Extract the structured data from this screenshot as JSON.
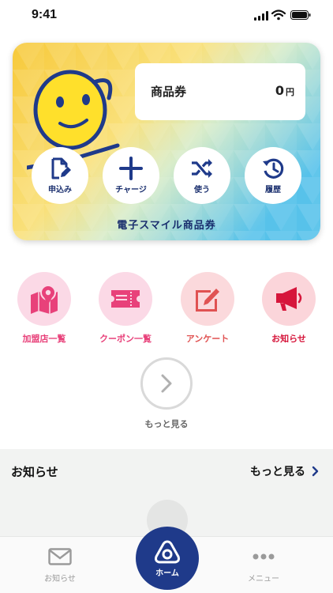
{
  "status_bar": {
    "time": "9:41"
  },
  "card": {
    "balance_label": "商品券",
    "balance_value": "0",
    "balance_unit": "円",
    "title": "電子スマイル商品券",
    "buttons": [
      {
        "label": "申込み",
        "icon": "apply-document-icon"
      },
      {
        "label": "チャージ",
        "icon": "plus-icon"
      },
      {
        "label": "使う",
        "icon": "shuffle-icon"
      },
      {
        "label": "履歴",
        "icon": "history-icon"
      }
    ]
  },
  "quick_menu": [
    {
      "label": "加盟店一覧",
      "icon": "map-pin-icon",
      "color": "#e8417a",
      "bg": "#fbd9e6"
    },
    {
      "label": "クーポン一覧",
      "icon": "ticket-icon",
      "color": "#e8417a",
      "bg": "#fbd9e6"
    },
    {
      "label": "アンケート",
      "icon": "edit-icon",
      "color": "#e05252",
      "bg": "#fbd9dc"
    },
    {
      "label": "お知らせ",
      "icon": "megaphone-icon",
      "color": "#d6163b",
      "bg": "#fbd5da"
    }
  ],
  "more": {
    "label": "もっと見る"
  },
  "news": {
    "title": "お知らせ",
    "more_label": "もっと見る"
  },
  "tabbar": {
    "items": [
      {
        "label": "お知らせ",
        "icon": "mail-icon"
      },
      {
        "label": "ホーム",
        "icon": "home-logo-icon"
      },
      {
        "label": "メニュー",
        "icon": "more-dots-icon"
      }
    ]
  },
  "colors": {
    "navy": "#1f3a8a",
    "pink": "#e8417a",
    "red": "#d6163b"
  }
}
